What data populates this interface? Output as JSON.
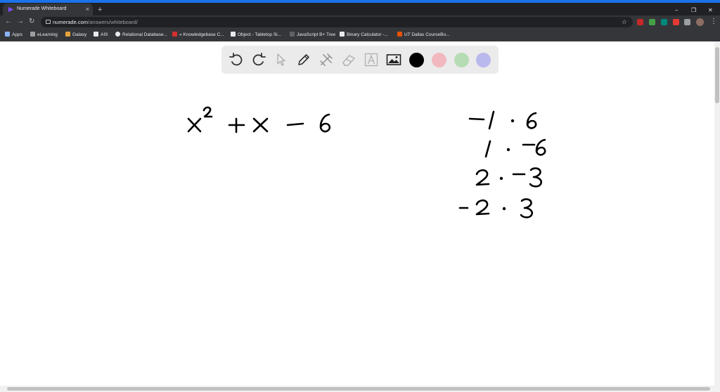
{
  "browser": {
    "tab_title": "Numerade Whiteboard",
    "tab_close": "×",
    "new_tab": "+",
    "url_host": "numerade.com",
    "url_path": "/answers/whiteboard/",
    "window_controls": [
      "–",
      "❐",
      "✕"
    ],
    "bookmarks": [
      {
        "label": "Apps",
        "icon": "apps-grid-icon",
        "color": "#8ab4f8"
      },
      {
        "label": "eLearning",
        "icon": "elearning-icon",
        "color": "#9e9e9e"
      },
      {
        "label": "Galaxy",
        "icon": "galaxy-icon",
        "color": "#e6a23c"
      },
      {
        "label": "AIS",
        "icon": "ais-icon",
        "color": "#e8eaed"
      },
      {
        "label": "Relational Database...",
        "icon": "github-icon",
        "color": "#e8eaed"
      },
      {
        "label": "» Knowledgebase C...",
        "icon": "knowledgebase-icon",
        "color": "#d32f2f"
      },
      {
        "label": "Object - Tabletop Si...",
        "icon": "tabletop-icon",
        "color": "#e8eaed"
      },
      {
        "label": "JavaScript B+ Tree",
        "icon": "page-icon",
        "color": "#5f6368"
      },
      {
        "label": "Binary Calculator -...",
        "icon": "calculator-icon",
        "color": "#e8eaed"
      },
      {
        "label": "UT Dallas CourseBo...",
        "icon": "utd-icon",
        "color": "#e65100"
      }
    ]
  },
  "whiteboard": {
    "tools": [
      "undo-icon",
      "redo-icon",
      "pointer-icon",
      "pencil-icon",
      "tools-icon",
      "eraser-icon",
      "text-icon",
      "image-icon"
    ],
    "colors": [
      "#000000",
      "#f2b8c0",
      "#b6dcb4",
      "#b9b9ee"
    ],
    "selected_color": "#000000",
    "handwriting": [
      {
        "kind": "expression",
        "content": "x^2 + x - 6"
      },
      {
        "kind": "factor_pair",
        "content": "-1 · 6"
      },
      {
        "kind": "factor_pair",
        "content": "1 · -6"
      },
      {
        "kind": "factor_pair",
        "content": "2 · -3"
      },
      {
        "kind": "factor_pair",
        "content": "-2 · 3"
      }
    ]
  }
}
